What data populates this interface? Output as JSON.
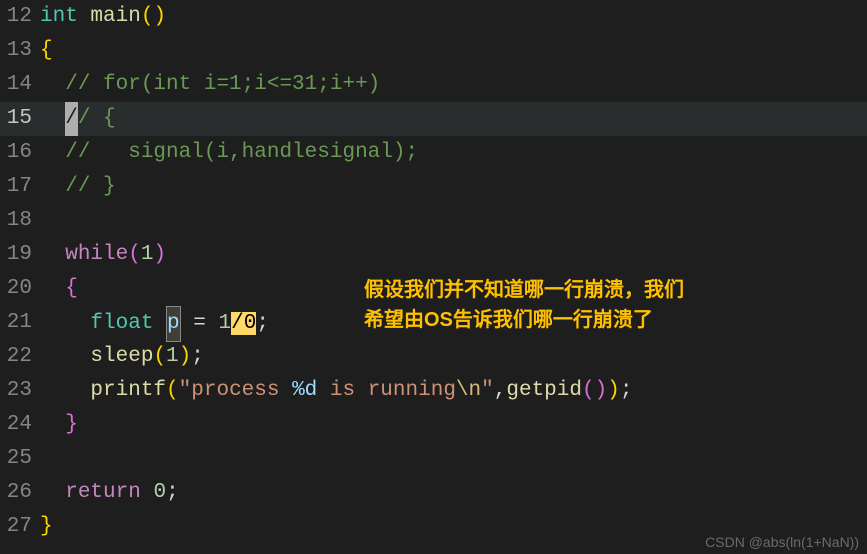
{
  "gutter": {
    "l12": "12",
    "l13": "13",
    "l14": "14",
    "l15": "15",
    "l16": "16",
    "l17": "17",
    "l18": "18",
    "l19": "19",
    "l20": "20",
    "l21": "21",
    "l22": "22",
    "l23": "23",
    "l24": "24",
    "l25": "25",
    "l26": "26",
    "l27": "27"
  },
  "code": {
    "l12_type": "int",
    "l12_space": " ",
    "l12_func": "main",
    "l12_paren": "()",
    "l13_brace": "{",
    "l14_indent": "  ",
    "l14_comment": "// for(int i=1;i<=31;i++)",
    "l15_indent": "  ",
    "l15_cursor": "/",
    "l15_rest": "/ {",
    "l16_indent": "  ",
    "l16_comment": "//   signal(i,handlesignal);",
    "l17_indent": "  ",
    "l17_comment": "// }",
    "l19_indent": "  ",
    "l19_while": "while",
    "l19_paren_o": "(",
    "l19_num": "1",
    "l19_paren_c": ")",
    "l20_indent": "  ",
    "l20_brace": "{",
    "l21_indent": "    ",
    "l21_type": "float",
    "l21_sp1": " ",
    "l21_var": "p",
    "l21_sp2": " ",
    "l21_eq": "=",
    "l21_sp3": " ",
    "l21_one": "1",
    "l21_div": "/",
    "l21_zero": "0",
    "l21_semi": ";",
    "l22_indent": "    ",
    "l22_func": "sleep",
    "l22_po": "(",
    "l22_num": "1",
    "l22_pc": ")",
    "l22_semi": ";",
    "l23_indent": "    ",
    "l23_func": "printf",
    "l23_po": "(",
    "l23_str1": "\"process ",
    "l23_fmt": "%d",
    "l23_str2": " is running",
    "l23_esc": "\\n",
    "l23_str3": "\"",
    "l23_comma": ",",
    "l23_func2": "getpid",
    "l23_p2o": "(",
    "l23_p2c": ")",
    "l23_pc": ")",
    "l23_semi": ";",
    "l24_indent": "  ",
    "l24_brace": "}",
    "l26_indent": "  ",
    "l26_return": "return",
    "l26_sp": " ",
    "l26_num": "0",
    "l26_semi": ";",
    "l27_brace": "}"
  },
  "annotation": {
    "line1": "假设我们并不知道哪一行崩溃，我们",
    "line2": "希望由OS告诉我们哪一行崩溃了"
  },
  "watermark": "CSDN @abs(ln(1+NaN))"
}
